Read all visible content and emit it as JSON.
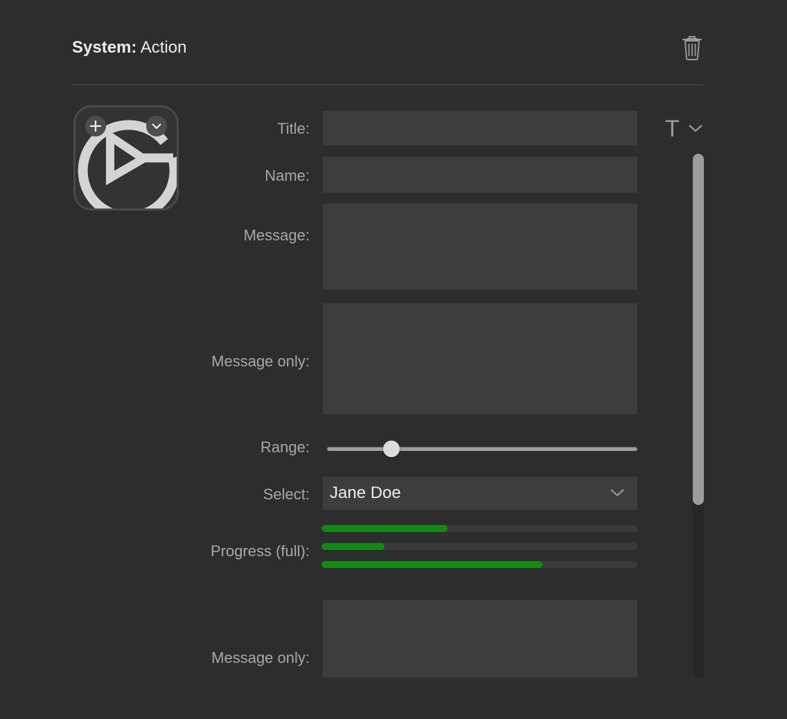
{
  "header": {
    "prefix": "System:",
    "title": "Action"
  },
  "icons": {
    "trash": "trash-icon",
    "action": "play-circle-icon",
    "add": "plus-icon",
    "menu": "chevron-down-icon"
  },
  "form": {
    "title_label": "Title:",
    "title_value": "",
    "type_toggle": "T",
    "name_label": "Name:",
    "name_value": "",
    "message_label": "Message:",
    "message_value": "",
    "message_only_label": "Message only:",
    "message_only_value": "",
    "range_label": "Range:",
    "range_value": 0.19,
    "select_label": "Select:",
    "select_value": "Jane Doe",
    "progress_label": "Progress (full):",
    "progress_values": [
      0.4,
      0.2,
      0.7
    ],
    "message_only_2_label": "Message only:",
    "message_only_2_value": ""
  },
  "scrollbar": {
    "position": 0.0,
    "visible_fraction": 0.67
  },
  "colors": {
    "background": "#2d2d2d",
    "field": "#3d3d3d",
    "progress_fill": "#138a13",
    "label": "#a8a8a8"
  }
}
